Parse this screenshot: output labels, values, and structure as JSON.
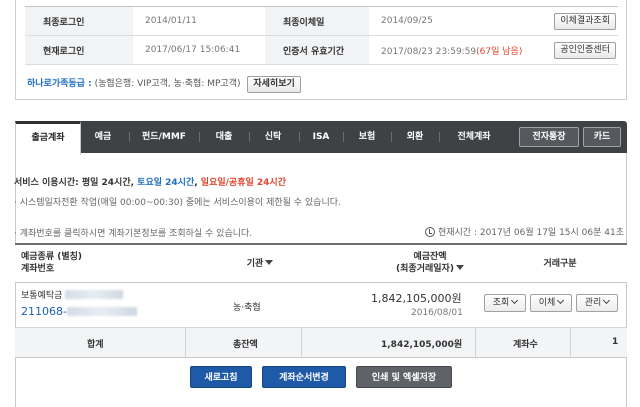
{
  "info": {
    "rows": [
      {
        "label1": "최종로그인",
        "value1": "2014/01/11",
        "label2": "최종이체일",
        "value2": "2014/09/25",
        "button": "이체결과조회",
        "extra": ""
      },
      {
        "label1": "현재로그인",
        "value1": "2017/06/17 15:06:41",
        "label2": "인증서 유효기간",
        "value2": "2017/08/23 23:59:59",
        "extra": "(67일 남음)",
        "button": "공인인증센터"
      }
    ],
    "grade_label": "하나로가족등급 :",
    "grade_text": "(농협은행: VIP고객, 농·축협: MP고객)",
    "grade_button": "자세히보기"
  },
  "tabs": [
    "출금계좌",
    "예금",
    "펀드/MMF",
    "대출",
    "신탁",
    "ISA",
    "보험",
    "외환",
    "전체계좌"
  ],
  "tab_right": [
    "전자통장",
    "카드"
  ],
  "notice": {
    "prefix": "서비스 이용시간: 평일 24시간, ",
    "saturday": "토요일 24시간",
    "sep": ", ",
    "holiday": "일요일/공휴일 24시간",
    "maintenance": "· 시스템일자전환 작업(매일 00:00~00:30) 중에는 서비스이용이 제한될 수 있습니다.",
    "account_hint": "· 계좌번호를 클릭하시면 계좌기본정보를 조회하실 수 있습니다.",
    "current_time": "현재시간 : 2017년 06월 17일 15시 06분 41초"
  },
  "table": {
    "headers": {
      "type_line1": "예금종류 (별칭)",
      "type_line2": "계좌번호",
      "org": "기관",
      "balance_line1": "예금잔액",
      "balance_line2": "(최종거래일자)",
      "trade": "거래구분"
    },
    "row": {
      "product": "보통예탁금",
      "account_prefix": "211068-",
      "org": "농·축협",
      "balance": "1,842,105,000원",
      "last_date": "2016/08/01",
      "actions": [
        "조회",
        "이체",
        "관리"
      ]
    },
    "total": {
      "label": "합계",
      "sum_label": "총잔액",
      "sum_value": "1,842,105,000원",
      "count_label": "계좌수",
      "count_value": "1"
    }
  },
  "buttons": [
    "새로고침",
    "계좌순서변경",
    "인쇄 및 엑셀저장"
  ],
  "colors": {
    "accent_blue": "#1f6fc1",
    "red": "#e0462f",
    "tab_bg": "#3f4245",
    "button_blue": "#1e5aa8"
  }
}
